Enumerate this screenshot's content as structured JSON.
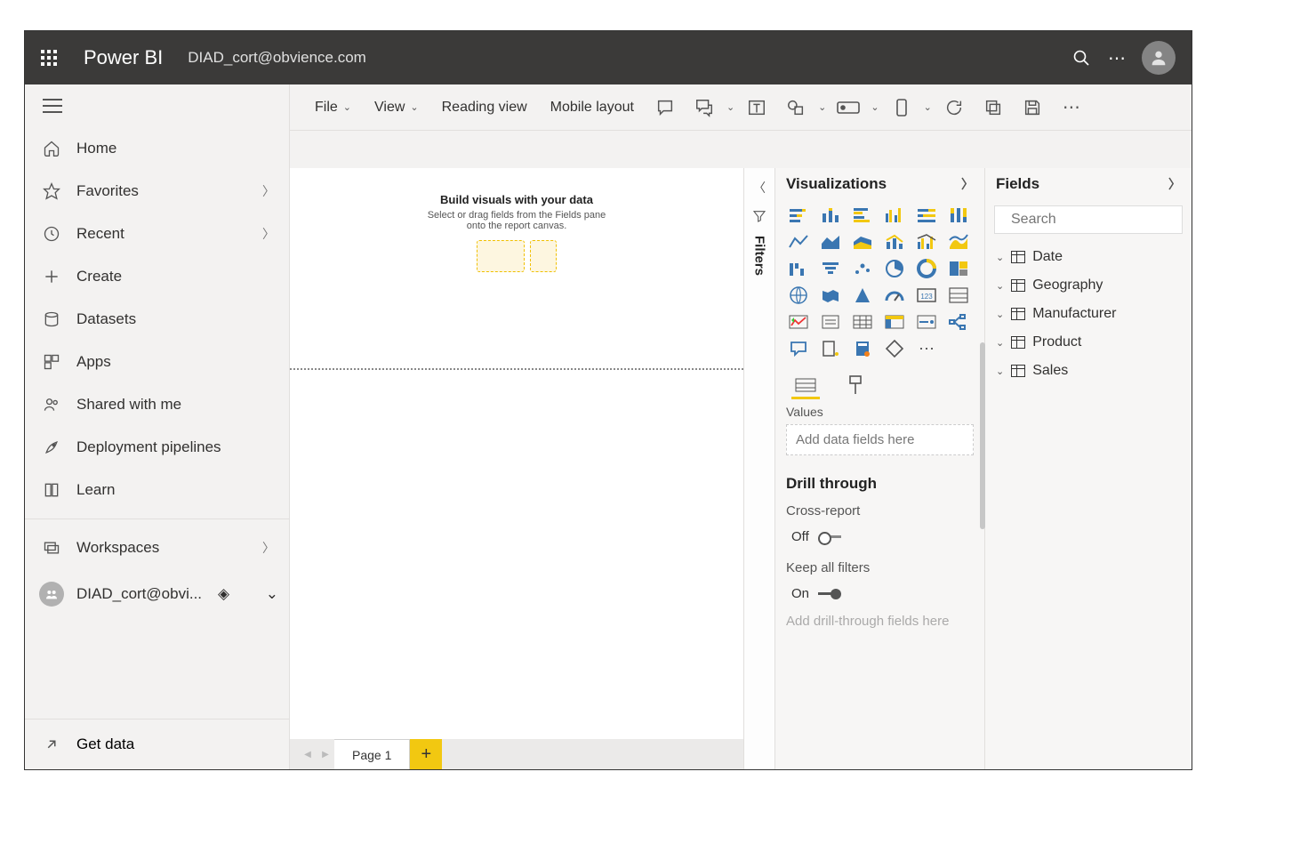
{
  "topbar": {
    "brand": "Power BI",
    "account": "DIAD_cort@obvience.com"
  },
  "toolbar": {
    "file": "File",
    "view": "View",
    "reading_view": "Reading view",
    "mobile_layout": "Mobile layout"
  },
  "nav": {
    "home": "Home",
    "favorites": "Favorites",
    "recent": "Recent",
    "create": "Create",
    "datasets": "Datasets",
    "apps": "Apps",
    "shared": "Shared with me",
    "pipelines": "Deployment pipelines",
    "learn": "Learn",
    "workspaces": "Workspaces",
    "current_ws": "DIAD_cort@obvi...",
    "get_data": "Get data"
  },
  "canvas": {
    "title": "Build visuals with your data",
    "subtitle1": "Select or drag fields from the Fields pane",
    "subtitle2": "onto the report canvas."
  },
  "pages": {
    "tab1": "Page 1"
  },
  "filters": {
    "label": "Filters"
  },
  "vis": {
    "title": "Visualizations",
    "values_label": "Values",
    "values_placeholder": "Add data fields here",
    "drill_title": "Drill through",
    "cross_report_label": "Cross-report",
    "cross_report_state": "Off",
    "keep_filters_label": "Keep all filters",
    "keep_filters_state": "On",
    "drill_placeholder": "Add drill-through fields here"
  },
  "fields": {
    "title": "Fields",
    "search_placeholder": "Search",
    "tables": [
      "Date",
      "Geography",
      "Manufacturer",
      "Product",
      "Sales"
    ]
  }
}
